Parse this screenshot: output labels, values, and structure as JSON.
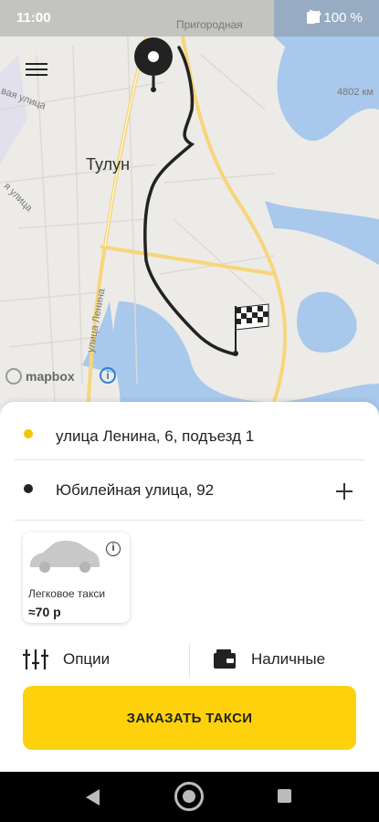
{
  "status_bar": {
    "time": "11:00",
    "battery": "100 %",
    "icons": [
      "wifi-icon",
      "signal-icon",
      "battery-icon"
    ]
  },
  "map": {
    "labels": {
      "pridorozhnaya": "Пригородная",
      "distance": "4802 км",
      "city": "Тулун",
      "lenina_street": "улица Ленина",
      "street_left": "вая улица",
      "street_left2": "я улица"
    },
    "attribution": "mapbox",
    "icons": [
      "menu-icon",
      "origin-pin-icon",
      "finish-flag-icon",
      "info-icon"
    ]
  },
  "route": {
    "from": "улица Ленина, 6, подъезд 1",
    "to": "Юбилейная улица, 92"
  },
  "tariff": {
    "name": "Легковое такси",
    "price": "≈70 р"
  },
  "options": {
    "options_label": "Опции",
    "payment_label": "Наличные"
  },
  "order_button": "ЗАКАЗАТЬ ТАКСИ",
  "colors": {
    "accent": "#fdd20c",
    "from_dot": "#f5c400",
    "to_dot": "#222222",
    "water": "#a8c8ec",
    "road": "#f7d57a",
    "route": "#222222"
  }
}
